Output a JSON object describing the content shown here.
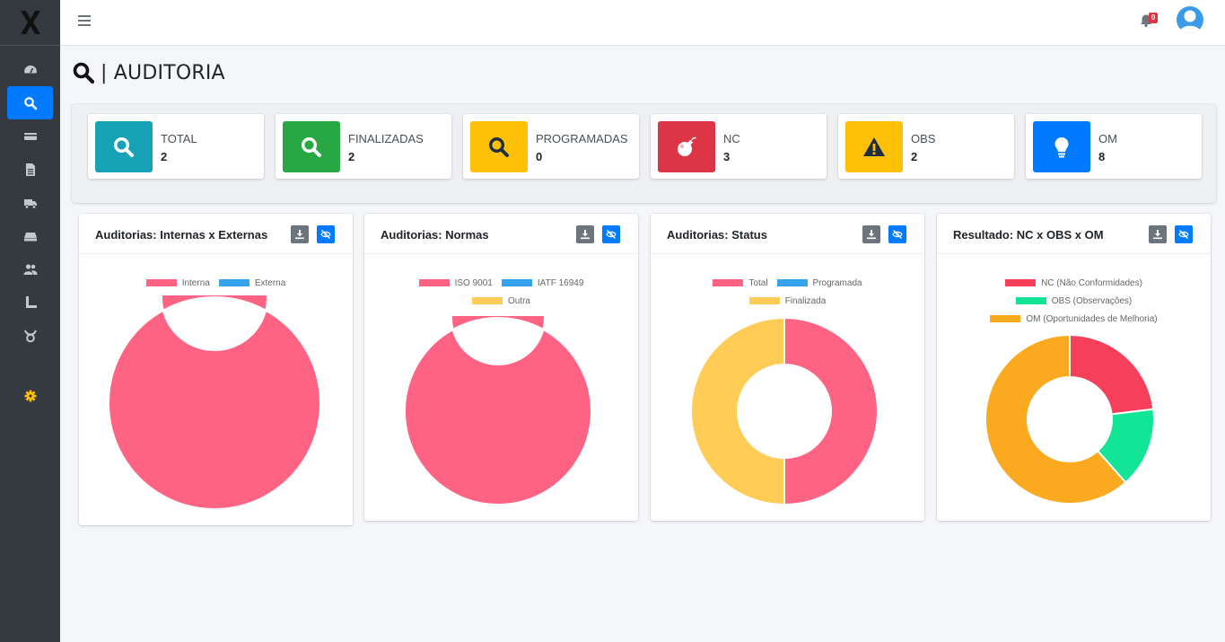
{
  "page": {
    "title": "| AUDITORIA"
  },
  "topbar": {
    "notification_count": "0"
  },
  "sidebar": {
    "items": [
      {
        "icon": "dashboard-icon",
        "active": false
      },
      {
        "icon": "search-icon",
        "active": true
      },
      {
        "icon": "card-icon",
        "active": false
      },
      {
        "icon": "document-icon",
        "active": false
      },
      {
        "icon": "truck-icon",
        "active": false
      },
      {
        "icon": "tray-icon",
        "active": false
      },
      {
        "icon": "users-icon",
        "active": false
      },
      {
        "icon": "ruler-icon",
        "active": false
      },
      {
        "icon": "taurus-icon",
        "active": false
      },
      {
        "icon": "gear-icon",
        "active": false
      }
    ]
  },
  "stats": [
    {
      "label": "TOTAL",
      "value": "2",
      "color": "#17a2b8",
      "icon": "search-icon"
    },
    {
      "label": "FINALIZADAS",
      "value": "2",
      "color": "#28a745",
      "icon": "search-icon"
    },
    {
      "label": "PROGRAMADAS",
      "value": "0",
      "color": "#ffc107",
      "icon": "search-icon"
    },
    {
      "label": "NC",
      "value": "3",
      "color": "#dc3545",
      "icon": "bomb-icon"
    },
    {
      "label": "OBS",
      "value": "2",
      "color": "#ffc107",
      "icon": "warning-icon"
    },
    {
      "label": "OM",
      "value": "8",
      "color": "#007bff",
      "icon": "lightbulb-icon"
    }
  ],
  "cards": [
    {
      "title": "Auditorias: Internas x Externas"
    },
    {
      "title": "Auditorias: Normas"
    },
    {
      "title": "Auditorias: Status"
    },
    {
      "title": "Resultado: NC x OBS x OM"
    }
  ],
  "chart_data": [
    {
      "type": "pie",
      "donut": true,
      "title": "Auditorias: Internas x Externas",
      "categories": [
        "Interna",
        "Externa"
      ],
      "values": [
        2,
        0
      ],
      "colors": [
        "#ff6384",
        "#36a2eb"
      ],
      "legend": "top"
    },
    {
      "type": "pie",
      "donut": true,
      "title": "Auditorias: Normas",
      "categories": [
        "ISO 9001",
        "IATF 16949",
        "Outra"
      ],
      "values": [
        2,
        0,
        0
      ],
      "colors": [
        "#ff6384",
        "#36a2eb",
        "#ffcd56"
      ],
      "legend": "top"
    },
    {
      "type": "pie",
      "donut": true,
      "title": "Auditorias: Status",
      "categories": [
        "Total",
        "Programada",
        "Finalizada"
      ],
      "values": [
        2,
        0,
        2
      ],
      "colors": [
        "#ff6384",
        "#36a2eb",
        "#ffcd56"
      ],
      "legend": "top"
    },
    {
      "type": "pie",
      "donut": true,
      "title": "Resultado: NC x OBS x OM",
      "categories": [
        "NC (Não Conformidades)",
        "OBS (Observações)",
        "OM (Oportunidades de Melhoria)"
      ],
      "values": [
        3,
        2,
        8
      ],
      "colors": [
        "#f53f5b",
        "#13e597",
        "#fbaa1f"
      ],
      "legend": "top"
    }
  ]
}
